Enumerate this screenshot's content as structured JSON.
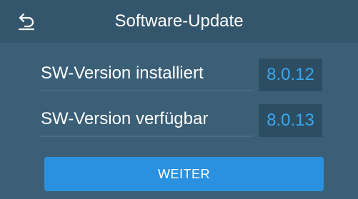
{
  "header": {
    "title": "Software-Update",
    "back_icon": "back-arrow-icon"
  },
  "versions": [
    {
      "label": "SW-Version installiert",
      "value": "8.0.12"
    },
    {
      "label": "SW-Version verfügbar",
      "value": "8.0.13"
    }
  ],
  "actions": {
    "next_label": "WEITER"
  },
  "colors": {
    "background": "#3a5f77",
    "header": "#34566d",
    "value_box": "#2d4d62",
    "value_text": "#3aa8ee",
    "button": "#2991e0"
  }
}
